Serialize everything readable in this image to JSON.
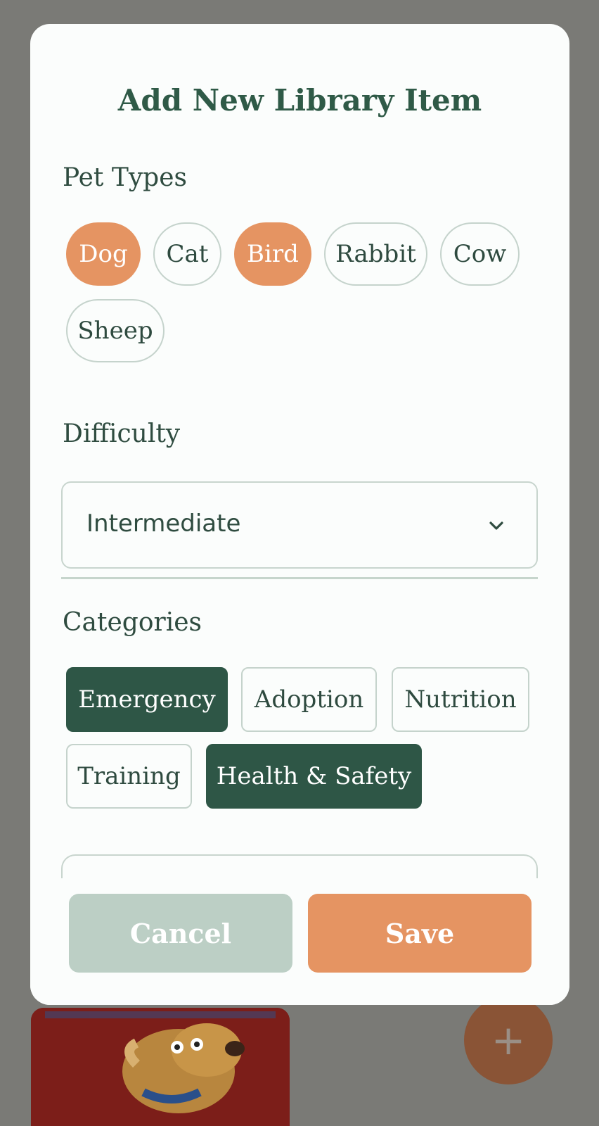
{
  "modal": {
    "title": "Add New Library Item",
    "cancel_label": "Cancel",
    "save_label": "Save"
  },
  "pet_types": {
    "label": "Pet Types",
    "options": [
      {
        "label": "Dog",
        "selected": true
      },
      {
        "label": "Cat",
        "selected": false
      },
      {
        "label": "Bird",
        "selected": true
      },
      {
        "label": "Rabbit",
        "selected": false
      },
      {
        "label": "Cow",
        "selected": false
      },
      {
        "label": "Sheep",
        "selected": false
      }
    ]
  },
  "difficulty": {
    "label": "Difficulty",
    "value": "Intermediate",
    "icon": "chevron-down-icon"
  },
  "categories": {
    "label": "Categories",
    "options": [
      {
        "label": "Emergency",
        "selected": true
      },
      {
        "label": "Adoption",
        "selected": false
      },
      {
        "label": "Nutrition",
        "selected": false
      },
      {
        "label": "Training",
        "selected": false
      },
      {
        "label": "Health & Safety",
        "selected": true
      }
    ]
  },
  "background": {
    "fab_icon": "plus-icon",
    "fab_symbol": "+"
  },
  "colors": {
    "accent_orange": "#e59462",
    "primary_green": "#2e5646",
    "muted_green": "#bccfc5"
  }
}
